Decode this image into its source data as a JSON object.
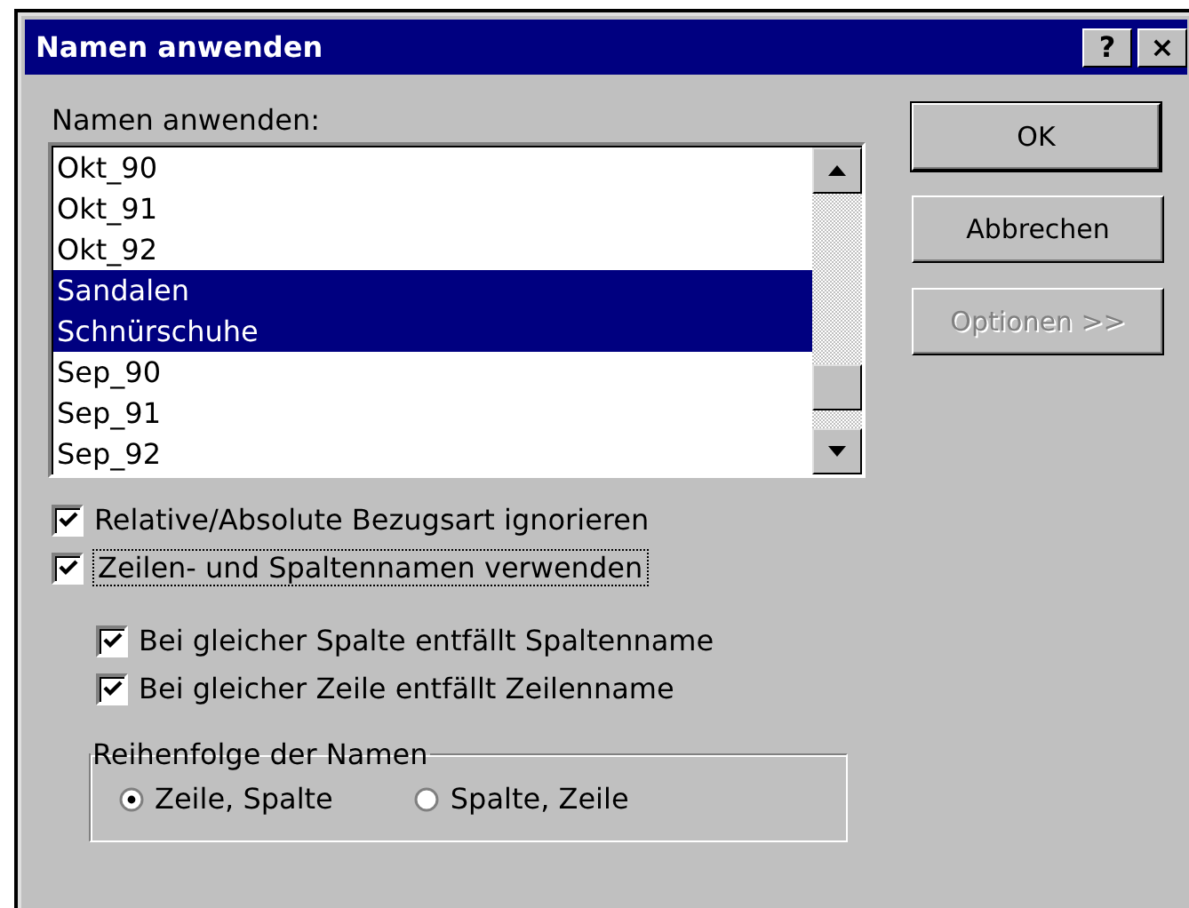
{
  "window": {
    "title": "Namen anwenden",
    "title_buttons": [
      "?",
      "×"
    ]
  },
  "list_label": "Namen anwenden:",
  "names": [
    {
      "label": "Okt_90",
      "selected": false
    },
    {
      "label": "Okt_91",
      "selected": false
    },
    {
      "label": "Okt_92",
      "selected": false
    },
    {
      "label": "Sandalen",
      "selected": true
    },
    {
      "label": "Schnürschuhe",
      "selected": true
    },
    {
      "label": "Sep_90",
      "selected": false
    },
    {
      "label": "Sep_91",
      "selected": false
    },
    {
      "label": "Sep_92",
      "selected": false
    }
  ],
  "buttons": [
    {
      "label": "OK",
      "default": true,
      "disabled": false
    },
    {
      "label": "Abbrechen",
      "default": false,
      "disabled": false
    },
    {
      "label": "Optionen >>",
      "default": false,
      "disabled": true
    }
  ],
  "options": [
    {
      "label": "Relative/Absolute Bezugsart ignorieren",
      "checked": true,
      "focused": false
    },
    {
      "label": "Zeilen- und Spaltennamen verwenden",
      "checked": true,
      "focused": true,
      "children": [
        {
          "label": "Bei gleicher Spalte entfällt Spaltenname",
          "checked": true,
          "focused": false
        },
        {
          "label": "Bei gleicher Zeile entfällt Zeilenname",
          "checked": true,
          "focused": false
        }
      ]
    }
  ],
  "order_group": {
    "title": "Reihenfolge der Namen",
    "choices": [
      {
        "label": "Zeile, Spalte",
        "selected": true
      },
      {
        "label": "Spalte, Zeile",
        "selected": false
      }
    ]
  }
}
